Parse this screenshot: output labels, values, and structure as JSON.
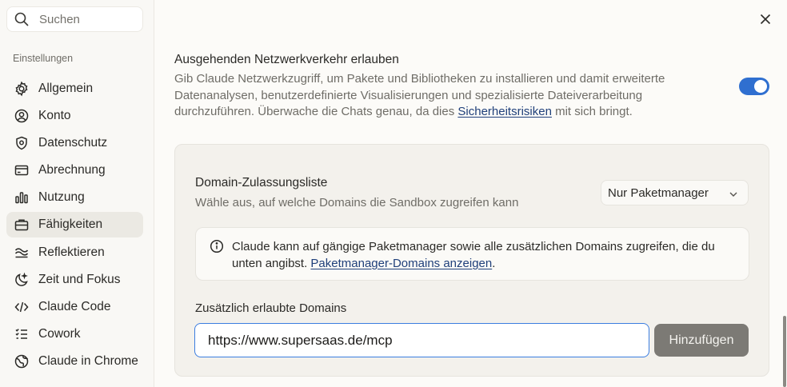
{
  "sidebar": {
    "search_placeholder": "Suchen",
    "section_label": "Einstellungen",
    "items": [
      {
        "label": "Allgemein",
        "icon": "gear-icon"
      },
      {
        "label": "Konto",
        "icon": "user-circle-icon"
      },
      {
        "label": "Datenschutz",
        "icon": "shield-icon"
      },
      {
        "label": "Abrechnung",
        "icon": "credit-card-icon"
      },
      {
        "label": "Nutzung",
        "icon": "bar-chart-icon"
      },
      {
        "label": "Fähigkeiten",
        "icon": "toolbox-icon",
        "active": true
      },
      {
        "label": "Reflektieren",
        "icon": "waves-icon"
      },
      {
        "label": "Zeit und Fokus",
        "icon": "moon-icon"
      },
      {
        "label": "Claude Code",
        "icon": "code-icon"
      },
      {
        "label": "Cowork",
        "icon": "list-icon"
      },
      {
        "label": "Claude in Chrome",
        "icon": "globe-icon"
      }
    ]
  },
  "main": {
    "title": "Ausgehenden Netzwerkverkehr erlauben",
    "description_pre": "Gib Claude Netzwerkzugriff, um Pakete und Bibliotheken zu installieren und damit erweiterte Datenanalysen, benutzerdefinierte Visualisierungen und spezialisierte Dateiverarbeitung durchzuführen. Überwache die Chats genau, da dies ",
    "description_link": "Sicherheitsrisiken",
    "description_post": " mit sich bringt.",
    "toggle_on": true,
    "accent_color": "#2f6fd0",
    "panel": {
      "title": "Domain-Zulassungsliste",
      "subtitle": "Wähle aus, auf welche Domains die Sandbox zugreifen kann",
      "select_value": "Nur Paketmanager",
      "info_text": "Claude kann auf gängige Paketmanager sowie alle zusätzlichen Domains zugreifen, die du unten angibst. ",
      "info_link": "Paketmanager-Domains anzeigen",
      "info_post": ".",
      "domains_label": "Zusätzlich erlaubte Domains",
      "domain_input_value": "https://www.supersaas.de/mcp",
      "add_button": "Hinzufügen"
    }
  }
}
